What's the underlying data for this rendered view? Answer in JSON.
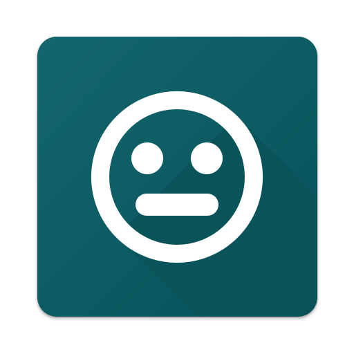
{
  "icon": {
    "name": "neutral-face-icon",
    "colors": {
      "tile": "#0a5e66",
      "tile_light": "#13666d",
      "tile_dark": "#075159",
      "long_shadow": "#04454c",
      "glyph": "#ffffff"
    }
  }
}
